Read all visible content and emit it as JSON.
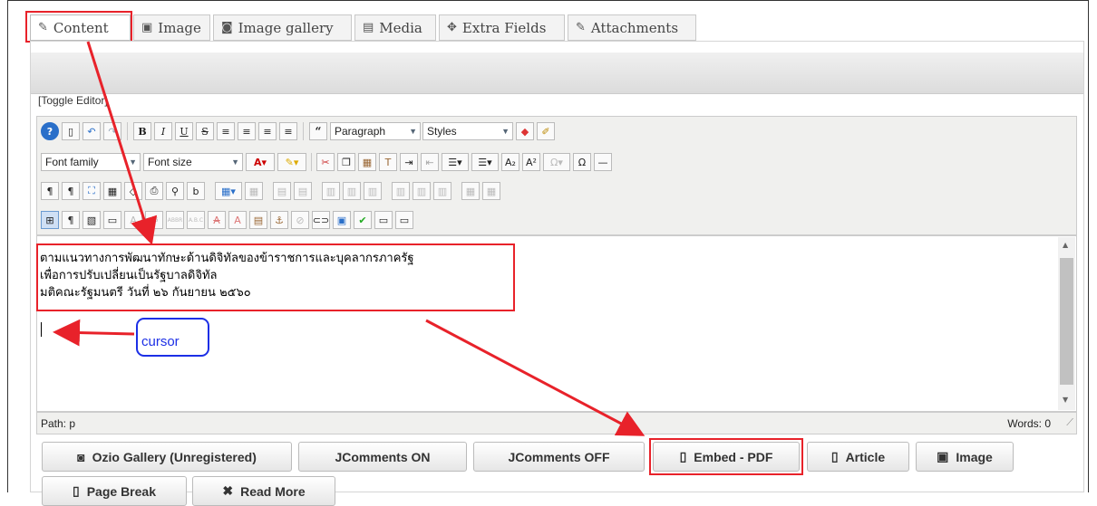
{
  "tabs": [
    {
      "label": "Content",
      "icon": "edit-icon",
      "glyph": "✎"
    },
    {
      "label": "Image",
      "icon": "image-icon",
      "glyph": "▣"
    },
    {
      "label": "Image gallery",
      "icon": "camera-icon",
      "glyph": "◙"
    },
    {
      "label": "Media",
      "icon": "film-icon",
      "glyph": "▤"
    },
    {
      "label": "Extra Fields",
      "icon": "puzzle-icon",
      "glyph": "✥"
    },
    {
      "label": "Attachments",
      "icon": "paperclip-icon",
      "glyph": "✎"
    }
  ],
  "toggle_editor": "[Toggle Editor]",
  "toolbar": {
    "paragraph": "Paragraph",
    "styles": "Styles",
    "font_family": "Font family",
    "font_size": "Font size"
  },
  "editor": {
    "lines": [
      "ตามแนวทางการพัฒนาทักษะด้านดิจิทัลของข้าราชการและบุคลากรภาครัฐ",
      "เพื่อการปรับเปลี่ยนเป็นรัฐบาลดิจิทัล",
      "มติคณะรัฐมนตรี วันที่ ๒๖ กันยายน ๒๕๖๐"
    ]
  },
  "annotation": {
    "cursor_label": "cursor"
  },
  "status": {
    "path": "Path: p",
    "words": "Words: 0"
  },
  "buttons": [
    {
      "label": "Ozio Gallery (Unregistered)",
      "icon": "camera-icon"
    },
    {
      "label": "JComments ON",
      "icon": ""
    },
    {
      "label": "JComments OFF",
      "icon": ""
    },
    {
      "label": "Embed - PDF",
      "icon": "file-icon"
    },
    {
      "label": "Article",
      "icon": "file-plus-icon"
    },
    {
      "label": "Image",
      "icon": "picture-icon"
    },
    {
      "label": "Page Break",
      "icon": "file-break-icon"
    },
    {
      "label": "Read More",
      "icon": "x-icon"
    }
  ],
  "colors": {
    "highlight": "#e8222a",
    "annotation_blue": "#1c2fe6"
  }
}
